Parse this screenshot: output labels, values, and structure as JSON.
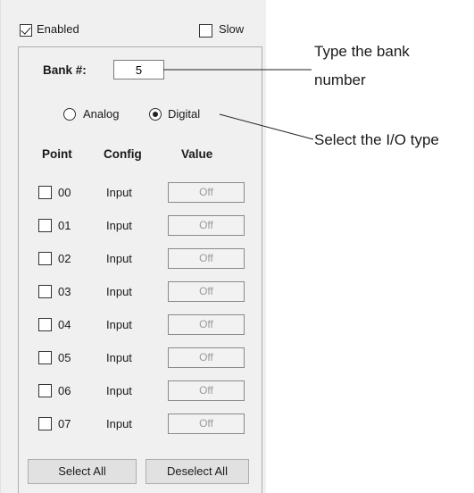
{
  "top": {
    "enabled": {
      "label": "Enabled",
      "checked": true
    },
    "slow": {
      "label": "Slow",
      "checked": false
    }
  },
  "bank": {
    "label": "Bank #:",
    "value": "5"
  },
  "io_type": {
    "analog": {
      "label": "Analog",
      "selected": false
    },
    "digital": {
      "label": "Digital",
      "selected": true
    }
  },
  "table": {
    "headers": {
      "point": "Point",
      "config": "Config",
      "value": "Value"
    },
    "rows": [
      {
        "point": "00",
        "config": "Input",
        "value": "Off"
      },
      {
        "point": "01",
        "config": "Input",
        "value": "Off"
      },
      {
        "point": "02",
        "config": "Input",
        "value": "Off"
      },
      {
        "point": "03",
        "config": "Input",
        "value": "Off"
      },
      {
        "point": "04",
        "config": "Input",
        "value": "Off"
      },
      {
        "point": "05",
        "config": "Input",
        "value": "Off"
      },
      {
        "point": "06",
        "config": "Input",
        "value": "Off"
      },
      {
        "point": "07",
        "config": "Input",
        "value": "Off"
      }
    ]
  },
  "buttons": {
    "select_all": "Select All",
    "deselect_all": "Deselect All"
  },
  "callouts": {
    "bank_line1": "Type the bank",
    "bank_line2": "number",
    "io_type": "Select the I/O type"
  }
}
